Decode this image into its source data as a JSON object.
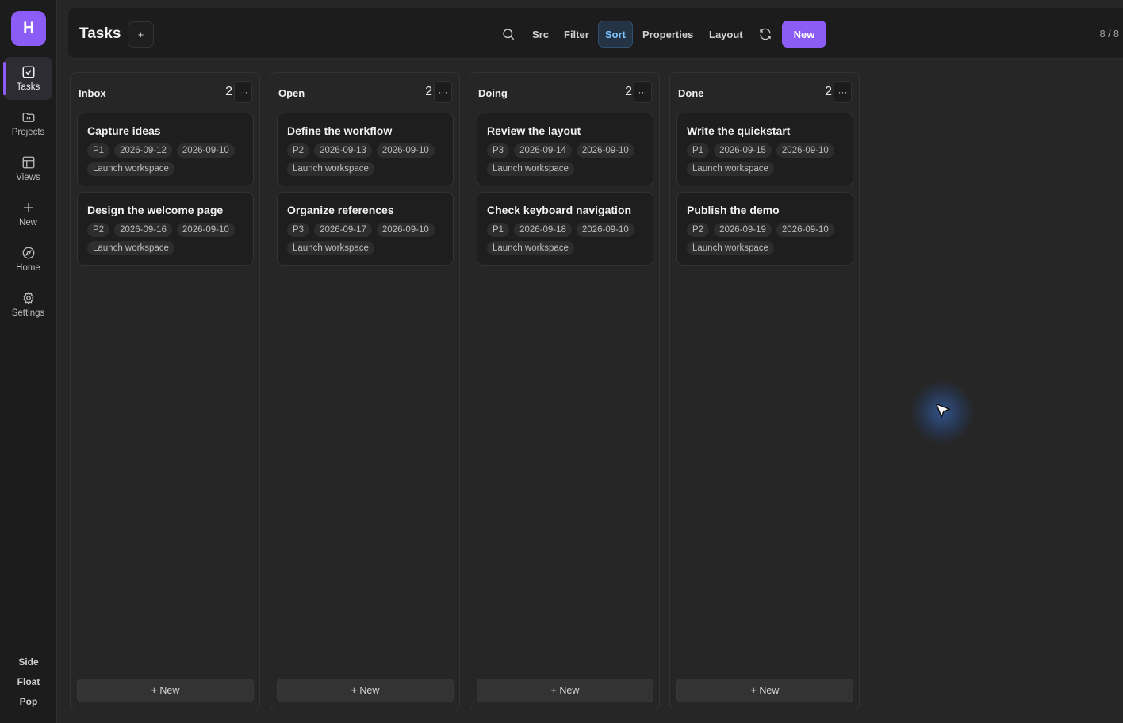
{
  "app": {
    "logo_letter": "H"
  },
  "sidebar": {
    "items": [
      {
        "label": "Tasks",
        "icon": "check-square-icon",
        "active": true
      },
      {
        "label": "Projects",
        "icon": "folder-icon"
      },
      {
        "label": "Views",
        "icon": "layout-icon"
      },
      {
        "label": "New",
        "icon": "plus-icon"
      },
      {
        "label": "Home",
        "icon": "compass-icon"
      },
      {
        "label": "Settings",
        "icon": "gear-icon"
      }
    ],
    "modes": [
      "Side",
      "Float",
      "Pop"
    ]
  },
  "header": {
    "title": "Tasks",
    "add_label": "+",
    "toolbar": {
      "src": "Src",
      "filter": "Filter",
      "sort": "Sort",
      "properties": "Properties",
      "layout": "Layout",
      "new": "New"
    },
    "counter": "8 / 8"
  },
  "board": {
    "more_label": "···",
    "add_card_label": "+ New",
    "columns": [
      {
        "title": "Inbox",
        "count": "2",
        "cards": [
          {
            "title": "Capture ideas",
            "priority": "P1",
            "due": "2026-09-12",
            "created": "2026-09-10",
            "project": "Launch workspace"
          },
          {
            "title": "Design the welcome page",
            "priority": "P2",
            "due": "2026-09-16",
            "created": "2026-09-10",
            "project": "Launch workspace"
          }
        ]
      },
      {
        "title": "Open",
        "count": "2",
        "cards": [
          {
            "title": "Define the workflow",
            "priority": "P2",
            "due": "2026-09-13",
            "created": "2026-09-10",
            "project": "Launch workspace"
          },
          {
            "title": "Organize references",
            "priority": "P3",
            "due": "2026-09-17",
            "created": "2026-09-10",
            "project": "Launch workspace"
          }
        ]
      },
      {
        "title": "Doing",
        "count": "2",
        "cards": [
          {
            "title": "Review the layout",
            "priority": "P3",
            "due": "2026-09-14",
            "created": "2026-09-10",
            "project": "Launch workspace"
          },
          {
            "title": "Check keyboard navigation",
            "priority": "P1",
            "due": "2026-09-18",
            "created": "2026-09-10",
            "project": "Launch workspace"
          }
        ]
      },
      {
        "title": "Done",
        "count": "2",
        "cards": [
          {
            "title": "Write the quickstart",
            "priority": "P1",
            "due": "2026-09-15",
            "created": "2026-09-10",
            "project": "Launch workspace"
          },
          {
            "title": "Publish the demo",
            "priority": "P2",
            "due": "2026-09-19",
            "created": "2026-09-10",
            "project": "Launch workspace"
          }
        ]
      }
    ]
  },
  "colors": {
    "accent": "#8b5cf6",
    "sort_active": "#7cc4ff",
    "background": "#262626",
    "panel": "#1c1c1c"
  }
}
